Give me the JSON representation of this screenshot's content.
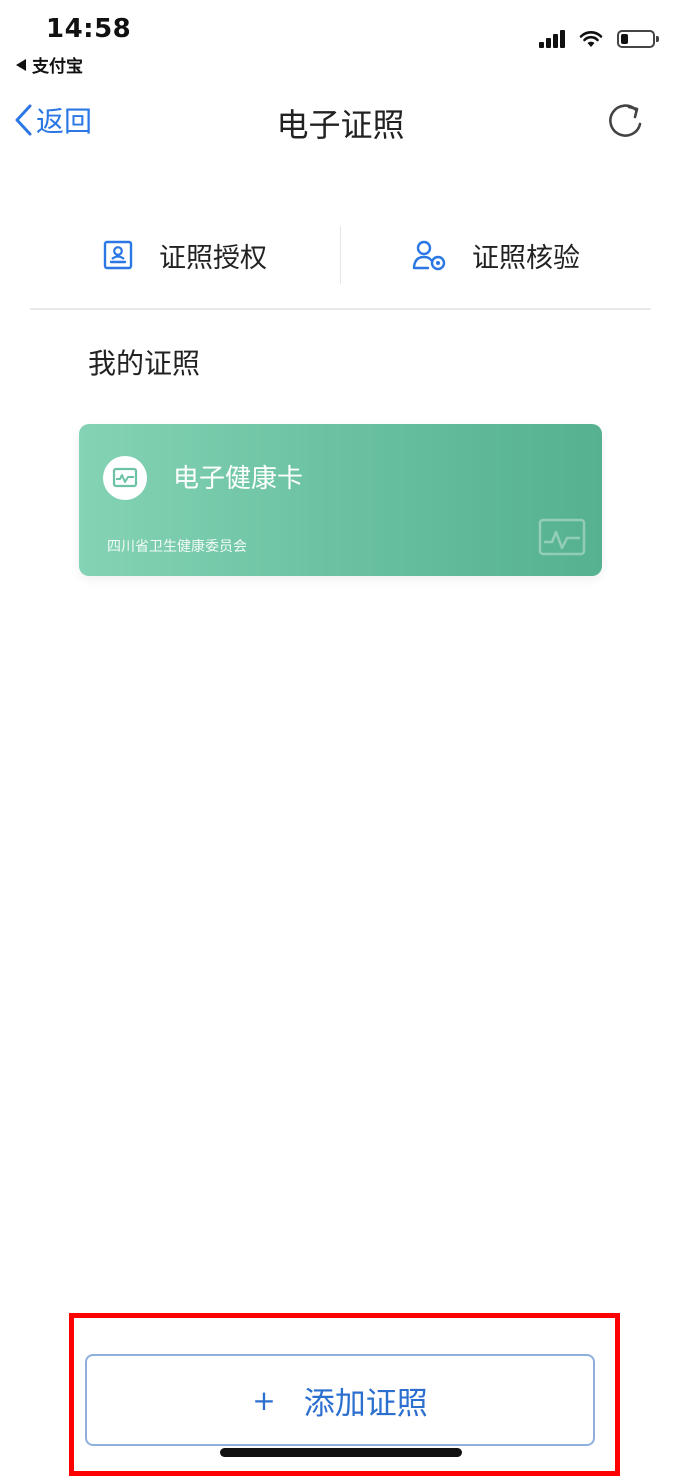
{
  "status_bar": {
    "time": "14:58",
    "back_app": "支付宝",
    "icons": [
      "cellular-signal-icon",
      "wifi-icon",
      "battery-icon"
    ]
  },
  "nav": {
    "back_label": "返回",
    "title": "电子证照",
    "refresh_icon": "refresh-icon"
  },
  "actions": [
    {
      "label": "证照授权",
      "icon": "id-card-icon"
    },
    {
      "label": "证照核验",
      "icon": "user-verify-icon"
    }
  ],
  "section": {
    "title": "我的证照"
  },
  "card": {
    "title": "电子健康卡",
    "issuer": "四川省卫生健康委员会",
    "icon": "health-monitor-icon",
    "colors": {
      "start": "#84d3b4",
      "end": "#55b190"
    }
  },
  "footer": {
    "plus": "+",
    "add_label": "添加证照"
  },
  "colors": {
    "accent": "#2b78e4",
    "highlight": "#ff0000"
  }
}
